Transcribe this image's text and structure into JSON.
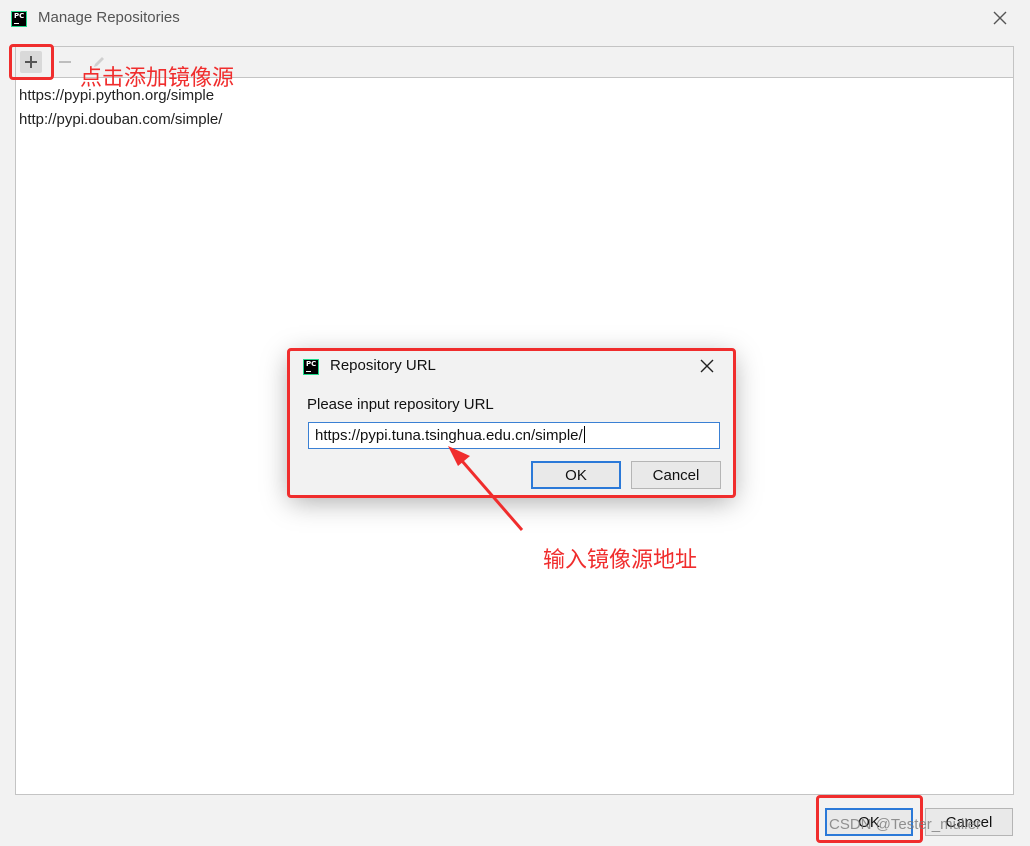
{
  "window": {
    "title": "Manage Repositories",
    "app_icon": "pycharm-icon",
    "close_icon": "close-icon"
  },
  "toolbar": {
    "add_icon": "plus-icon",
    "remove_icon": "minus-icon",
    "edit_icon": "pencil-icon"
  },
  "repositories": [
    "https://pypi.python.org/simple",
    "http://pypi.douban.com/simple/"
  ],
  "footer": {
    "ok_label": "OK",
    "cancel_label": "Cancel"
  },
  "dialog": {
    "title": "Repository URL",
    "prompt": "Please input repository URL",
    "input_value": "https://pypi.tuna.tsinghua.edu.cn/simple/",
    "ok_label": "OK",
    "cancel_label": "Cancel"
  },
  "annotations": {
    "add_hint": "点击添加镜像源",
    "input_hint": "输入镜像源地址",
    "color": "#f02d2d"
  },
  "watermark": "CSDN @Tester_muller",
  "colors": {
    "accent": "#2b79d8",
    "annotation": "#f02d2d"
  }
}
